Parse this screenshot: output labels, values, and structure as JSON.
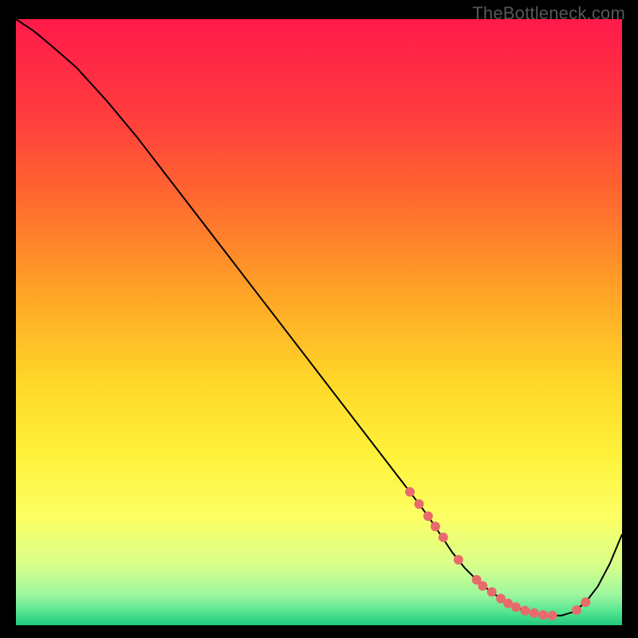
{
  "watermark": "TheBottleneck.com",
  "chart_data": {
    "type": "line",
    "title": "",
    "xlabel": "",
    "ylabel": "",
    "xlim": [
      0,
      100
    ],
    "ylim": [
      0,
      100
    ],
    "grid": false,
    "legend": false,
    "background": "rainbow-gradient",
    "gradient_stops": [
      {
        "pos": 0.0,
        "color": "#ff1a4a"
      },
      {
        "pos": 0.15,
        "color": "#ff3a3f"
      },
      {
        "pos": 0.3,
        "color": "#ff6a2f"
      },
      {
        "pos": 0.45,
        "color": "#ffa326"
      },
      {
        "pos": 0.6,
        "color": "#ffd829"
      },
      {
        "pos": 0.72,
        "color": "#fff23b"
      },
      {
        "pos": 0.82,
        "color": "#fdff63"
      },
      {
        "pos": 0.9,
        "color": "#d8ff8a"
      },
      {
        "pos": 0.95,
        "color": "#9df79f"
      },
      {
        "pos": 0.98,
        "color": "#4fe38f"
      },
      {
        "pos": 1.0,
        "color": "#1fc87d"
      }
    ],
    "series": [
      {
        "name": "curve",
        "color": "#000000",
        "stroke_width": 2,
        "x": [
          0,
          3,
          6,
          10,
          15,
          20,
          25,
          30,
          35,
          40,
          45,
          50,
          55,
          60,
          65,
          68,
          70,
          72,
          74,
          76,
          78,
          80,
          82,
          84,
          86,
          88,
          90,
          92,
          94,
          96,
          98,
          100
        ],
        "y": [
          100,
          98,
          95.5,
          92,
          86.5,
          80.5,
          74,
          67.5,
          61,
          54.5,
          48,
          41.5,
          35,
          28.5,
          22,
          18,
          15,
          12,
          9.5,
          7.5,
          5.8,
          4.4,
          3.2,
          2.4,
          1.8,
          1.6,
          1.6,
          2.2,
          3.8,
          6.4,
          10.2,
          15
        ]
      }
    ],
    "markers": {
      "color": "#e86b6b",
      "radius": 6,
      "points": [
        {
          "x": 65.0,
          "y": 22.0
        },
        {
          "x": 66.5,
          "y": 20.0
        },
        {
          "x": 68.0,
          "y": 18.0
        },
        {
          "x": 69.2,
          "y": 16.3
        },
        {
          "x": 70.5,
          "y": 14.5
        },
        {
          "x": 73.0,
          "y": 10.8
        },
        {
          "x": 76.0,
          "y": 7.5
        },
        {
          "x": 77.0,
          "y": 6.5
        },
        {
          "x": 78.5,
          "y": 5.5
        },
        {
          "x": 80.0,
          "y": 4.4
        },
        {
          "x": 81.2,
          "y": 3.6
        },
        {
          "x": 82.5,
          "y": 3.0
        },
        {
          "x": 84.0,
          "y": 2.4
        },
        {
          "x": 85.5,
          "y": 2.0
        },
        {
          "x": 87.0,
          "y": 1.7
        },
        {
          "x": 88.5,
          "y": 1.6
        },
        {
          "x": 92.5,
          "y": 2.5
        },
        {
          "x": 94.0,
          "y": 3.8
        }
      ]
    }
  }
}
